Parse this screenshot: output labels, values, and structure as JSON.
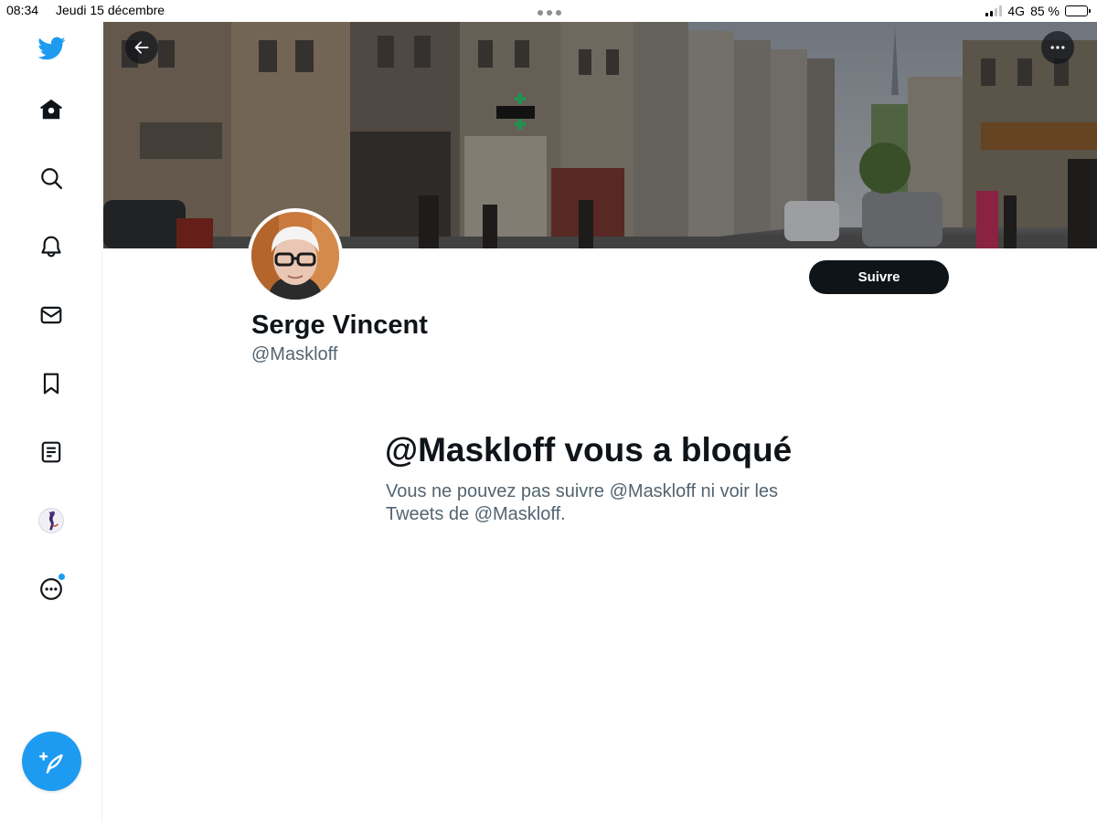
{
  "status_bar": {
    "time": "08:34",
    "date": "Jeudi 15 décembre",
    "network": "4G",
    "battery": "85 %",
    "battery_level": 0.85
  },
  "sidebar": {
    "items": [
      {
        "name": "twitter-logo-icon"
      },
      {
        "name": "home-icon"
      },
      {
        "name": "search-icon"
      },
      {
        "name": "notifications-bell-icon"
      },
      {
        "name": "messages-envelope-icon"
      },
      {
        "name": "bookmark-icon"
      },
      {
        "name": "lists-icon"
      },
      {
        "name": "profile-avatar-icon"
      },
      {
        "name": "more-options-icon"
      }
    ],
    "compose": {
      "name": "compose-tweet-icon"
    }
  },
  "profile": {
    "display_name": "Serge Vincent",
    "handle": "@Maskloff",
    "follow_label": "Suivre"
  },
  "blocked": {
    "title": "@Maskloff vous a bloqué",
    "description": "Vous ne pouvez pas suivre @Maskloff ni voir les Tweets de @Maskloff."
  },
  "colors": {
    "brand": "#1d9bf0",
    "text_primary": "#0f1419",
    "text_secondary": "#536471",
    "notification_dot": "#1d9bf0"
  }
}
